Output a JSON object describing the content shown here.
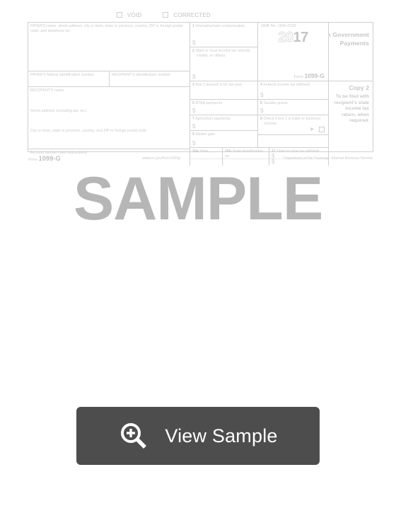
{
  "document": {
    "checkboxes": [
      {
        "label": "VOID",
        "checked": false
      },
      {
        "label": "CORRECTED",
        "checked": false
      }
    ],
    "payer_block_label": "PAYER'S name, street address, city or town, state or province, country, ZIP or foreign postal code, and telephone no.",
    "payer_tin_label": "PAYER'S federal identification number",
    "recipient_tin_label": "RECIPIENT'S identification number",
    "recipient_name_label": "RECIPIENT'S name",
    "street_label": "Street address (including apt. no.)",
    "city_label": "City or town, state or province, country, and ZIP or foreign postal code",
    "account_label": "Account number (see instructions)",
    "boxes": {
      "b1_num": "1",
      "b1_label": "Unemployment compensation",
      "b2_num": "2",
      "b2_label": "State or local income tax refunds, credits, or offsets",
      "b3_num": "3",
      "b3_label": "Box 2 amount is for tax year",
      "b4_num": "4",
      "b4_label": "Federal income tax withheld",
      "b5_num": "5",
      "b5_label": "RTAA payments",
      "b6_num": "6",
      "b6_label": "Taxable grants",
      "b7_num": "7",
      "b7_label": "Agriculture payments",
      "b8_num": "8",
      "b8_label": "Check if box 2 is trade or business income",
      "b9_num": "9",
      "b9_label": "Market gain",
      "b10a_num": "10a",
      "b10a_label": "State",
      "b10b_num": "10b",
      "b10b_label": "State identification no.",
      "b11_num": "11",
      "b11_label": "State income tax withheld"
    },
    "currency_symbol": "$",
    "omb": "OMB No. 1545-0120",
    "year_light": "20",
    "year_bold": "17",
    "form_prefix": "Form",
    "form_number": "1099-G",
    "title": "Certain Government Payments",
    "copy_label": "Copy 2",
    "copy_note": "To be filed with recipient's state income tax return, when required.",
    "footer_form_prefix": "Form",
    "footer_form_number": "1099-G",
    "footer_url": "www.irs.gov/form1099g",
    "footer_dept": "Department of the Treasury - Internal Revenue Service",
    "arrow_glyph": "▶"
  },
  "watermark": {
    "text": "SAMPLE",
    "color": "#b6b6b6"
  },
  "button": {
    "label": "View Sample",
    "icon": "zoom-in-icon",
    "background": "#4d4d4d",
    "text_color": "#ffffff"
  }
}
